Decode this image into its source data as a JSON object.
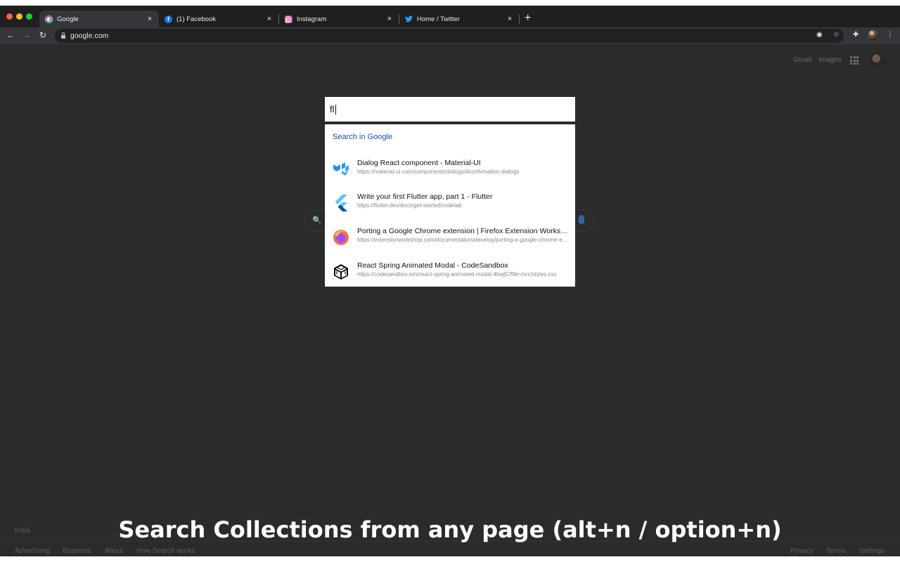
{
  "colors": {
    "window_bg": "#2a2a2a",
    "tabstrip_bg": "#1f1f1f",
    "toolbar_bg": "#35363a",
    "google_blue": "#1a4aa8",
    "mic_blue": "#3b62a8"
  },
  "browser": {
    "tabs": [
      {
        "title": "Google",
        "favicon": "google-favicon",
        "active": true,
        "close": "×"
      },
      {
        "title": "(1) Facebook",
        "favicon": "facebook-favicon",
        "active": false,
        "close": "×"
      },
      {
        "title": "Instagram",
        "favicon": "instagram-favicon",
        "active": false,
        "close": "×"
      },
      {
        "title": "Home / Twitter",
        "favicon": "twitter-favicon",
        "active": false,
        "close": "×"
      }
    ],
    "new_tab": "+",
    "nav": {
      "back": "←",
      "forward": "→",
      "reload": "↻"
    },
    "address": "google.com",
    "toolbar_icons": [
      "target-icon",
      "star-icon",
      "puzzle-icon",
      "profile-avatar",
      "more-icon"
    ],
    "toolbar_glyphs": {
      "target": "◉",
      "star": "☆",
      "puzzle": "✚",
      "more": "⋮"
    }
  },
  "google": {
    "header_links": [
      "Gmail",
      "Images"
    ],
    "country": "India",
    "footer_left": [
      "Advertising",
      "Business",
      "About",
      "How Search works"
    ],
    "footer_right": [
      "Privacy",
      "Terms",
      "Settings"
    ],
    "search_glyph": "🔍"
  },
  "overlay": {
    "query": "fl",
    "search_in_google": "Search in Google",
    "results": [
      {
        "title": "Dialog React component - Material-UI",
        "url": "https://material-ui.com/components/dialogs/#confirmation-dialogs",
        "icon": "material-ui-icon"
      },
      {
        "title": "Write your first Flutter app, part 1 - Flutter",
        "url": "https://flutter.dev/docs/get-started/codelab",
        "icon": "flutter-icon"
      },
      {
        "title": "Porting a Google Chrome extension | Firefox Extension Workshop",
        "url": "https://extensionworkshop.com/documentation/develop/porting-a-google-chrome-extension/",
        "icon": "firefox-icon"
      },
      {
        "title": "React Spring Animated Modal - CodeSandbox",
        "url": "https://codesandbox.io/s/react-spring-animated-modal-4bwj5?file=/src/styles.css",
        "icon": "codesandbox-icon"
      }
    ]
  },
  "caption": "Search Collections from any page (alt+n / option+n)"
}
